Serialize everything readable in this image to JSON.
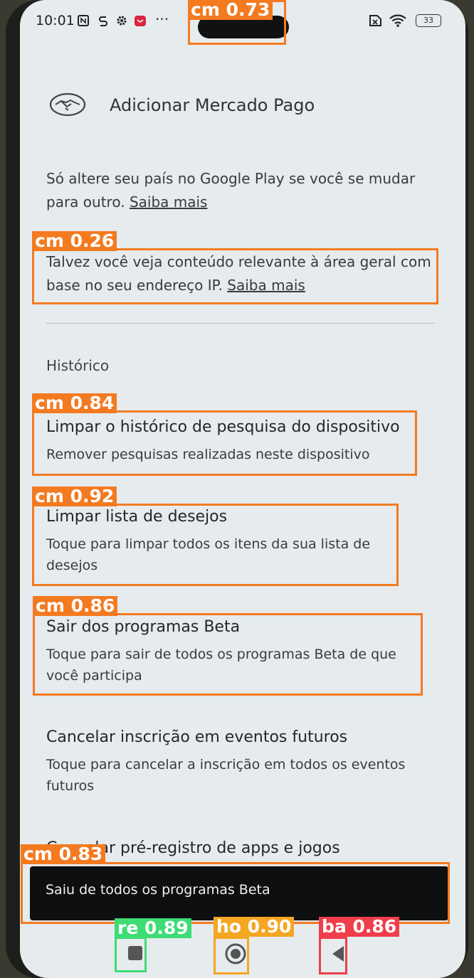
{
  "status_bar": {
    "time": "10:01",
    "battery": "33"
  },
  "header": {
    "title": "Adicionar Mercado Pago"
  },
  "country_notice": {
    "line1": "Só altere seu país no Google Play se você se mudar",
    "line2_prefix": "para outro. ",
    "link": "Saiba mais"
  },
  "ip_notice": {
    "line1": "Talvez você veja conteúdo relevante à área geral com",
    "line2_prefix": "base no seu endereço IP. ",
    "link": "Saiba mais"
  },
  "history": {
    "section_title": "Histórico",
    "items": [
      {
        "title": "Limpar o histórico de pesquisa do dispositivo",
        "sub1": "Remover pesquisas realizadas neste dispositivo",
        "sub2": ""
      },
      {
        "title": "Limpar lista de desejos",
        "sub1": "Toque para limpar todos os itens da sua lista de",
        "sub2": "desejos"
      },
      {
        "title": "Sair dos programas Beta",
        "sub1": "Toque para sair de todos os programas Beta de que",
        "sub2": "você participa"
      },
      {
        "title": "Cancelar inscrição em eventos futuros",
        "sub1": "Toque para cancelar a inscrição em todos os eventos",
        "sub2": "futuros"
      },
      {
        "title": "Cancelar pré-registro de apps e jogos",
        "sub1": "",
        "sub2": ""
      }
    ]
  },
  "snackbar": {
    "message": "Saiu de todos os programas Beta"
  },
  "detections": [
    {
      "label": "cm 0.73",
      "color": "#f47a20"
    },
    {
      "label": "cm 0.26",
      "color": "#f47a20"
    },
    {
      "label": "cm 0.84",
      "color": "#f47a20"
    },
    {
      "label": "cm 0.92",
      "color": "#f47a20"
    },
    {
      "label": "cm 0.86",
      "color": "#f47a20"
    },
    {
      "label": "cm 0.83",
      "color": "#f47a20"
    },
    {
      "label": "re 0.89",
      "color": "#3ddc74"
    },
    {
      "label": "ho 0.90",
      "color": "#f5a623"
    },
    {
      "label": "ba 0.86",
      "color": "#ef3e4a"
    }
  ],
  "nav_icons": [
    "recents-icon",
    "home-icon",
    "back-icon"
  ]
}
